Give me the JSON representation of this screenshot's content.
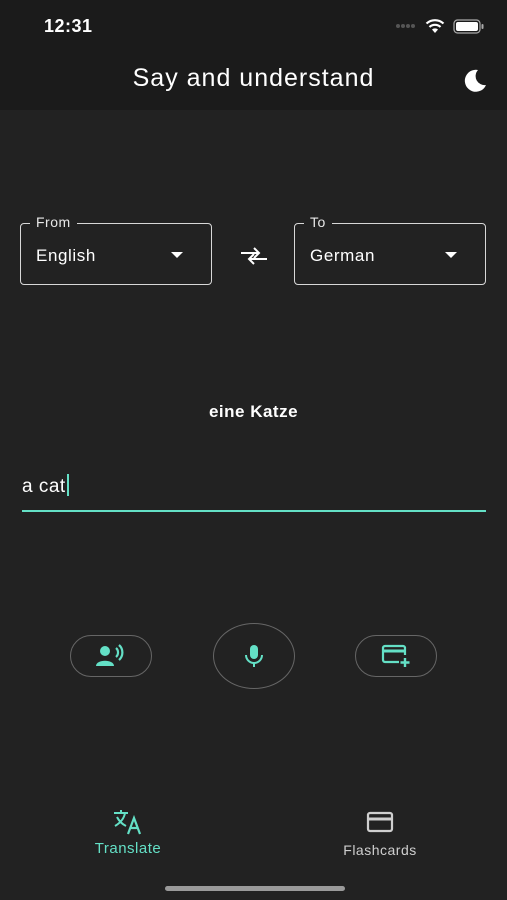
{
  "status": {
    "time": "12:31"
  },
  "app": {
    "title": "Say and understand"
  },
  "language": {
    "from_label": "From",
    "from_value": "English",
    "to_label": "To",
    "to_value": "German"
  },
  "translation": {
    "output": "eine Katze"
  },
  "input": {
    "value": "a cat"
  },
  "nav": {
    "translate_label": "Translate",
    "flashcards_label": "Flashcards"
  },
  "colors": {
    "accent": "#64e0c6",
    "background": "#222222",
    "appbar": "#1b1b1b"
  },
  "icons": [
    "signal-dots-icon",
    "wifi-icon",
    "battery-icon",
    "moon-icon",
    "swap-icon",
    "speaker-person-icon",
    "microphone-icon",
    "add-card-icon",
    "translate-icon",
    "flashcard-icon"
  ]
}
